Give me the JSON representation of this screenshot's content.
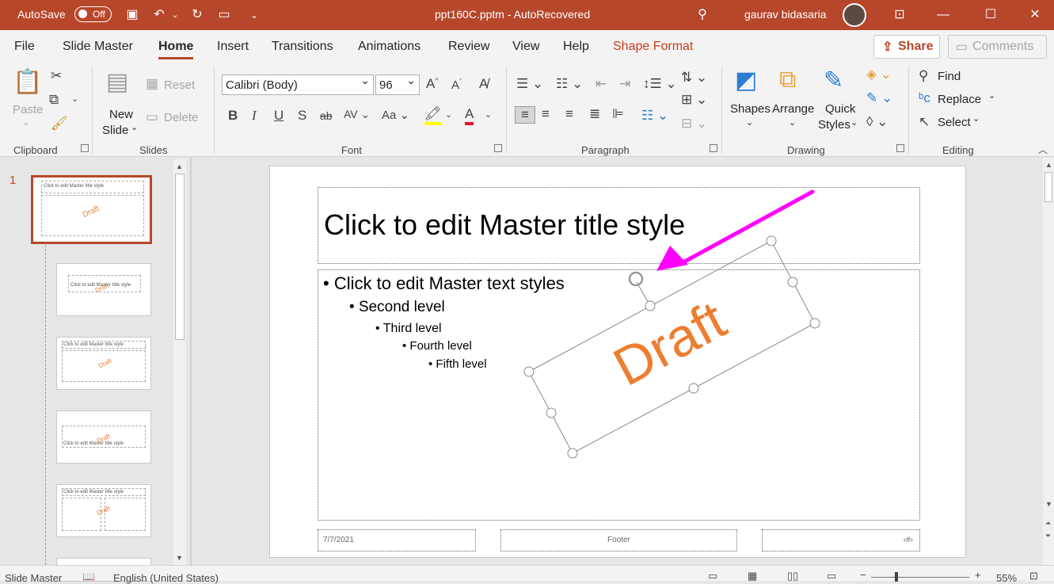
{
  "titlebar": {
    "autosave_label": "AutoSave",
    "autosave_state": "Off",
    "document_title": "ppt160C.pptm  -  AutoRecovered",
    "user_name": "gaurav bidasaria"
  },
  "tabs": [
    "File",
    "Slide Master",
    "Home",
    "Insert",
    "Transitions",
    "Animations",
    "Review",
    "View",
    "Help",
    "Shape Format"
  ],
  "share_label": "Share",
  "comments_label": "Comments",
  "ribbon": {
    "clipboard": {
      "paste": "Paste",
      "group": "Clipboard"
    },
    "slides": {
      "reset": "Reset",
      "new_slide_1": "New",
      "new_slide_2": "Slide",
      "delete": "Delete",
      "group": "Slides"
    },
    "font": {
      "family": "Calibri (Body)",
      "size": "96",
      "group": "Font"
    },
    "paragraph": {
      "group": "Paragraph"
    },
    "drawing": {
      "shapes": "Shapes",
      "arrange": "Arrange",
      "quick_styles_1": "Quick",
      "quick_styles_2": "Styles",
      "group": "Drawing"
    },
    "editing": {
      "find": "Find",
      "replace": "Replace",
      "select": "Select",
      "group": "Editing"
    }
  },
  "left_pane": {
    "slide_number": "1",
    "thumb_title": "Click to edit Master title style",
    "thumb_draft": "Draft"
  },
  "slide": {
    "title": "Click to edit Master title style",
    "levels": [
      "Click to edit Master text styles",
      "Second level",
      "Third level",
      "Fourth level",
      "Fifth level"
    ],
    "watermark": "Draft",
    "footer_date": "7/7/2021",
    "footer_text": "Footer",
    "footer_number": "‹#›",
    "accent_color": "#ed7d31",
    "arrow_color": "#ff00ff"
  },
  "statusbar": {
    "view": "Slide Master",
    "language": "English (United States)",
    "zoom": "55%"
  },
  "colors": {
    "brand": "#b7472a",
    "ribbon_bg": "#f3f3f3"
  }
}
